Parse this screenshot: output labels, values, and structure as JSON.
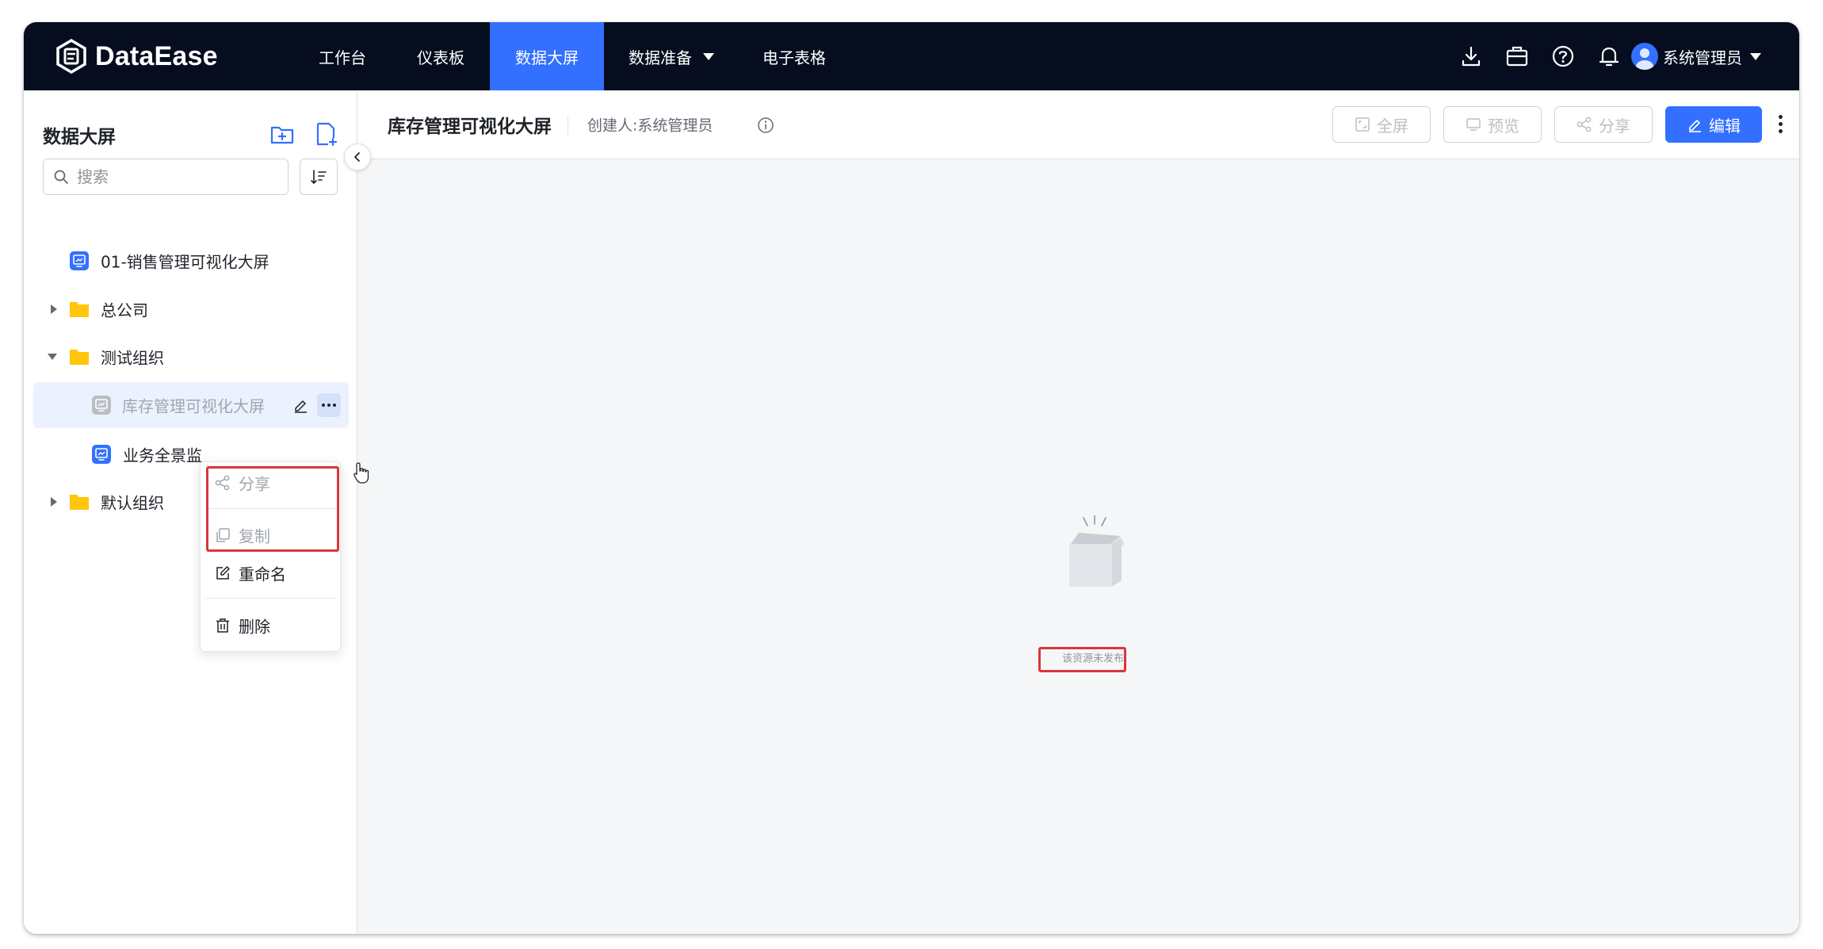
{
  "app": {
    "brand": "DataEase"
  },
  "nav": {
    "items": [
      {
        "label": "工作台"
      },
      {
        "label": "仪表板"
      },
      {
        "label": "数据大屏",
        "active": true
      },
      {
        "label": "数据准备",
        "dropdown": true
      },
      {
        "label": "电子表格"
      }
    ],
    "icons": [
      "download-icon",
      "briefcase-icon",
      "help-icon",
      "bell-icon"
    ],
    "user_name": "系统管理员"
  },
  "sidebar": {
    "title": "数据大屏",
    "search_placeholder": "搜索",
    "tree": [
      {
        "label": "01-销售管理可视化大屏",
        "type": "screen"
      },
      {
        "label": "总公司",
        "type": "folder",
        "expanded": false
      },
      {
        "label": "测试组织",
        "type": "folder",
        "expanded": true
      },
      {
        "label": "库存管理可视化大屏",
        "type": "screen",
        "selected": true
      },
      {
        "label": "业务全景监",
        "type": "screen"
      },
      {
        "label": "默认组织",
        "type": "folder",
        "expanded": false
      }
    ],
    "context_menu": [
      {
        "label": "分享",
        "icon": "share-icon",
        "disabled": true
      },
      {
        "label": "复制",
        "icon": "copy-icon",
        "disabled": true
      },
      {
        "label": "重命名",
        "icon": "edit-icon",
        "disabled": false
      },
      {
        "label": "删除",
        "icon": "trash-icon",
        "disabled": false
      }
    ]
  },
  "main": {
    "title": "库存管理可视化大屏",
    "creator": "创建人:系统管理员",
    "buttons": {
      "fullscreen": "全屏",
      "preview": "预览",
      "share": "分享",
      "edit": "编辑"
    },
    "empty_text": "该资源未发布"
  },
  "colors": {
    "nav_bg": "#050d1e",
    "accent": "#3370ff",
    "highlight_red": "#d9363e",
    "folder": "#ffc60a"
  }
}
